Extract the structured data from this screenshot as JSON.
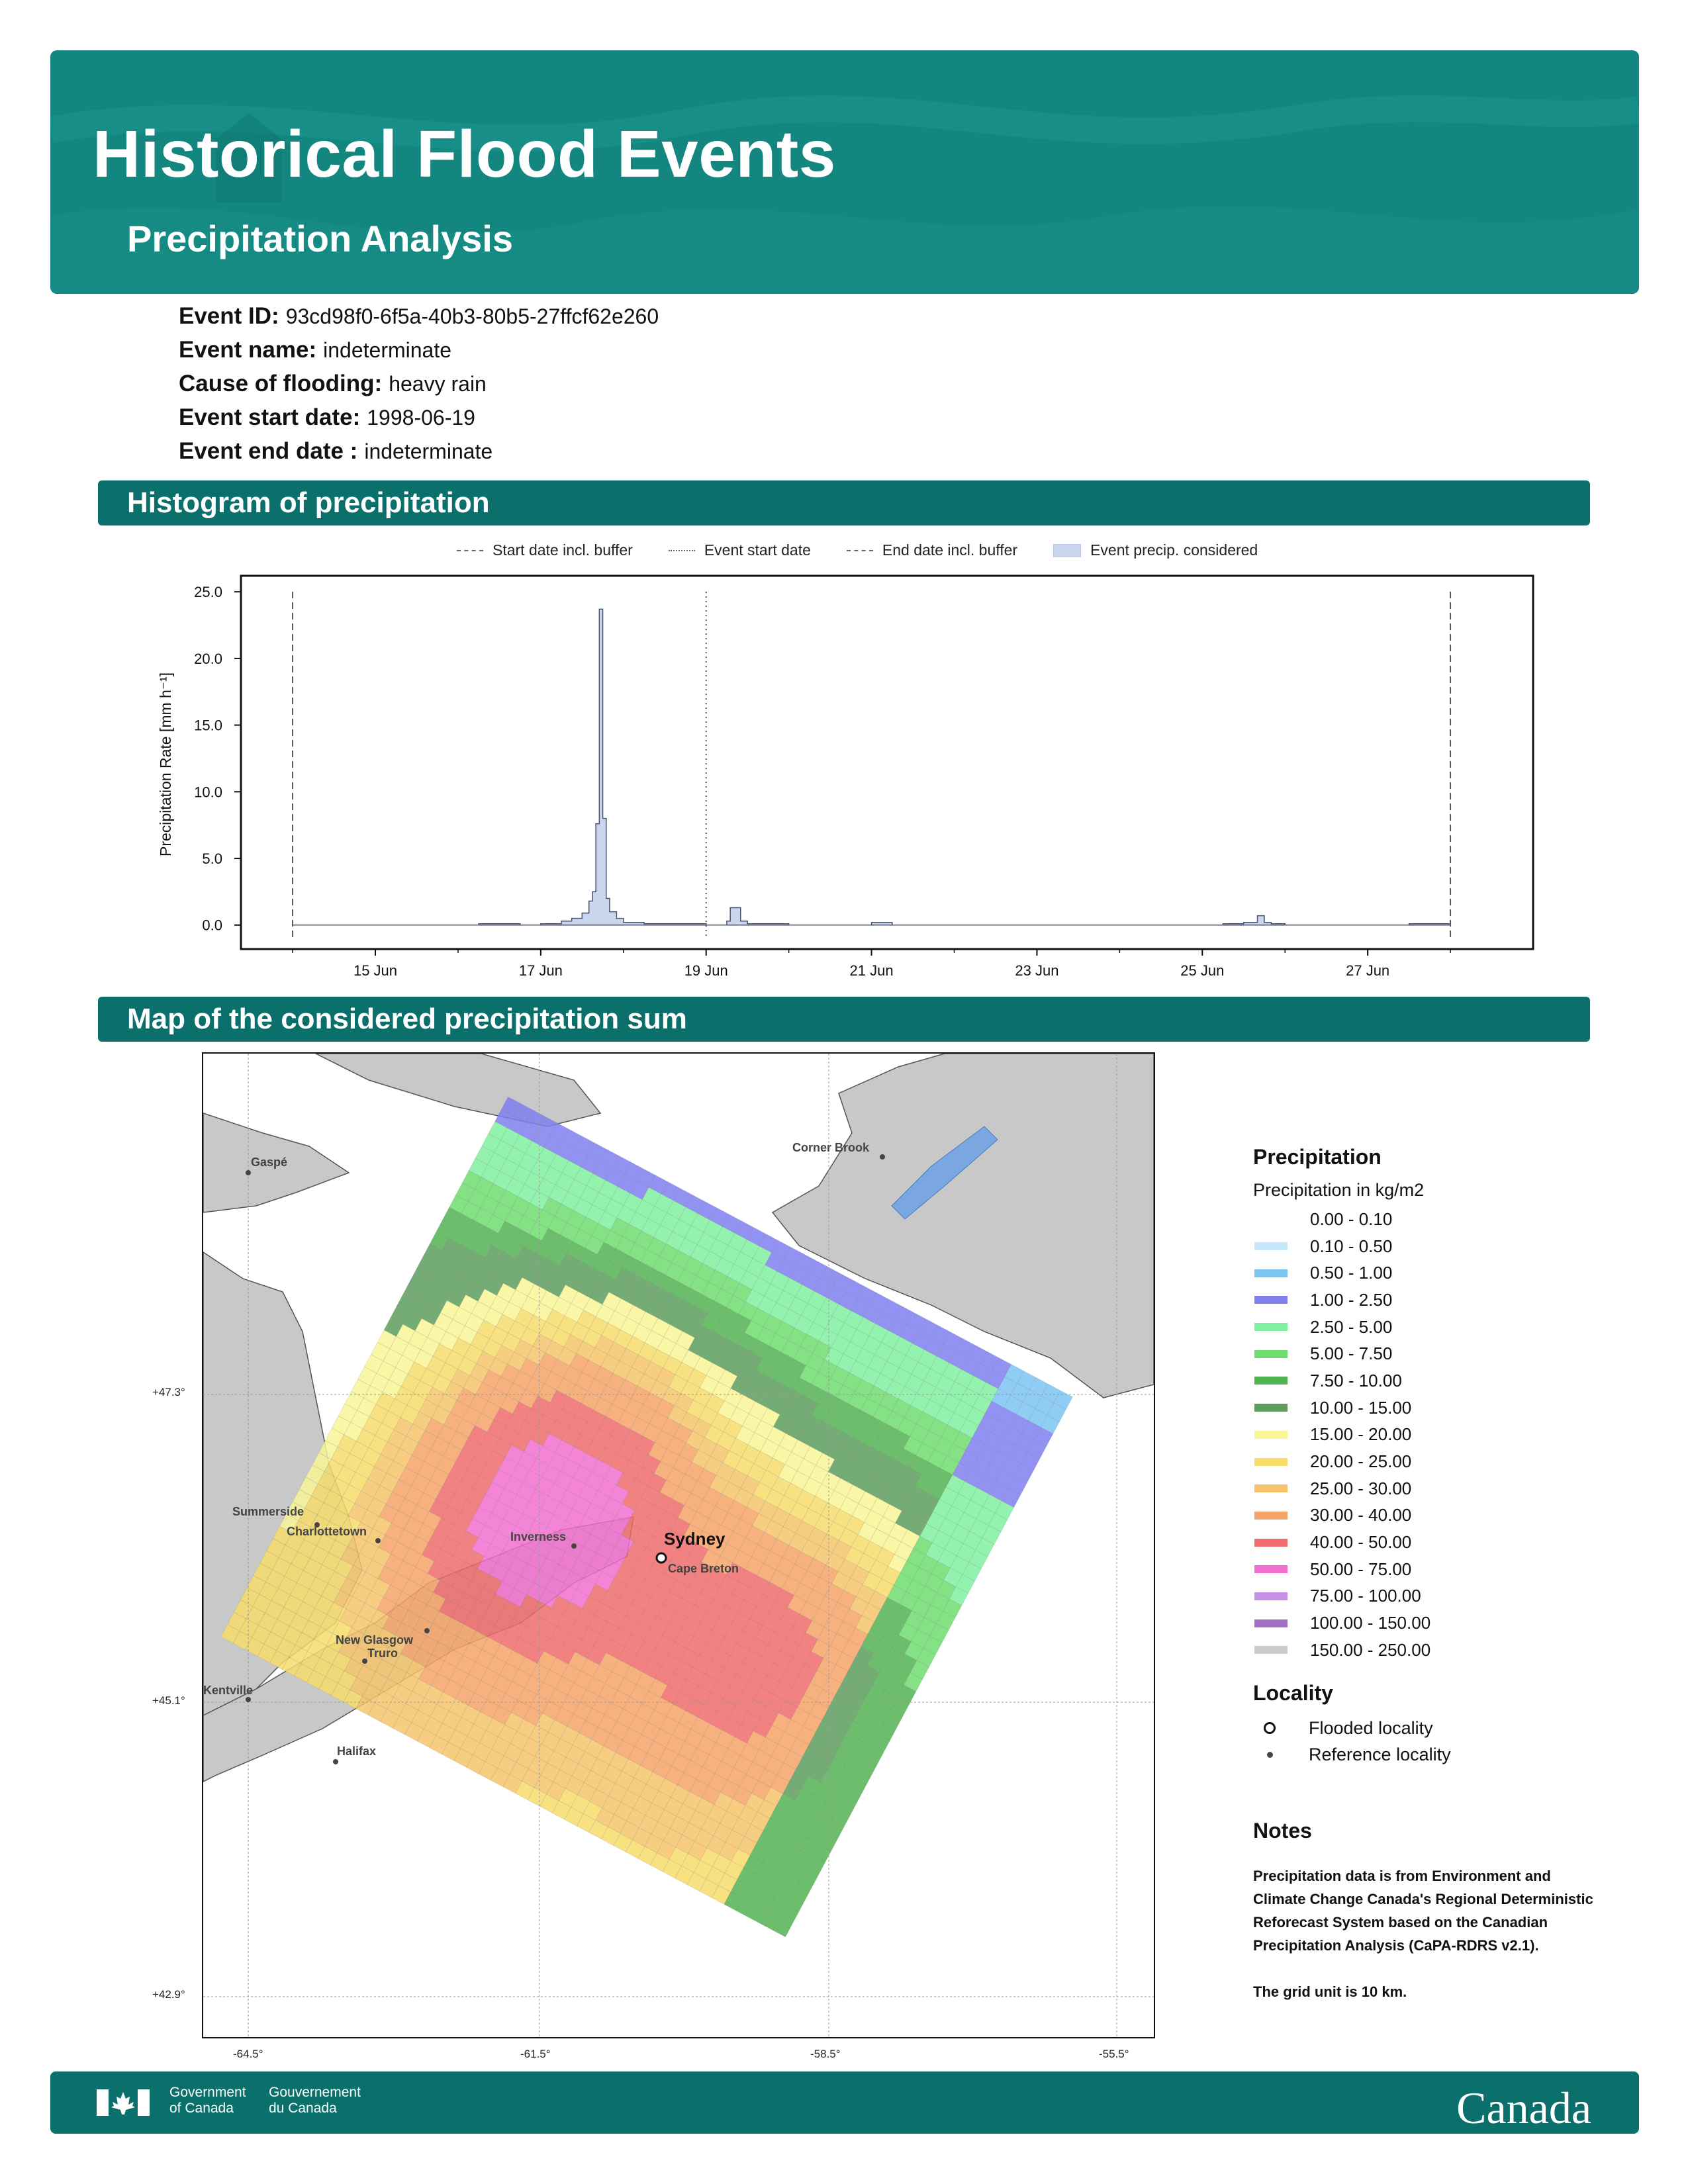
{
  "header": {
    "title": "Historical Flood Events",
    "subtitle": "Precipitation Analysis"
  },
  "event": {
    "id_label": "Event ID:",
    "id": "93cd98f0-6f5a-40b3-80b5-27ffcf62e260",
    "name_label": "Event name:",
    "name": "indeterminate",
    "cause_label": "Cause of flooding:",
    "cause": "heavy rain",
    "start_label": "Event start date:",
    "start": "1998-06-19",
    "end_label": "Event end date :",
    "end": "indeterminate"
  },
  "sections": {
    "histogram": "Histogram of precipitation",
    "map": "Map of the considered precipitation sum"
  },
  "histogram_legend": {
    "start_buffer": "Start date incl. buffer",
    "event_start": "Event start date",
    "end_buffer": "End date incl. buffer",
    "considered": "Event precip. considered"
  },
  "chart_data": {
    "type": "area",
    "ylabel": "Precipitation Rate [mm h⁻¹]",
    "xlabel": "",
    "ylim": [
      -1.8,
      26.2
    ],
    "xlim_days": [
      "1998-06-13T09:00",
      "1998-06-29T00:00"
    ],
    "y_ticks": [
      "0.0",
      "5.0",
      "10.0",
      "15.0",
      "20.0",
      "25.0"
    ],
    "x_ticks": [
      "15 Jun",
      "17 Jun",
      "19 Jun",
      "21 Jun",
      "23 Jun",
      "25 Jun",
      "27 Jun"
    ],
    "start_buffer": "1998-06-14",
    "event_start": "1998-06-19",
    "end_buffer": "1998-06-28",
    "series": [
      {
        "x": [
          "1998-06-14T00:00",
          "1998-06-16T06:00",
          "1998-06-16T12:00",
          "1998-06-16T18:00",
          "1998-06-17T00:00",
          "1998-06-17T06:00",
          "1998-06-17T09:00",
          "1998-06-17T12:00",
          "1998-06-17T14:00",
          "1998-06-17T15:00",
          "1998-06-17T16:00",
          "1998-06-17T17:00",
          "1998-06-17T18:00",
          "1998-06-17T19:00",
          "1998-06-17T20:00",
          "1998-06-17T22:00",
          "1998-06-18T00:00",
          "1998-06-18T06:00",
          "1998-06-18T12:00",
          "1998-06-19T00:00",
          "1998-06-19T06:00",
          "1998-06-19T07:00",
          "1998-06-19T09:00",
          "1998-06-19T10:00",
          "1998-06-19T12:00",
          "1998-06-20T00:00",
          "1998-06-20T18:00",
          "1998-06-21T00:00",
          "1998-06-21T06:00",
          "1998-06-22T00:00",
          "1998-06-24T00:00",
          "1998-06-25T06:00",
          "1998-06-25T12:00",
          "1998-06-25T16:00",
          "1998-06-25T17:00",
          "1998-06-25T18:00",
          "1998-06-25T20:00",
          "1998-06-26T00:00",
          "1998-06-27T00:00",
          "1998-06-27T12:00",
          "1998-06-28T00:00"
        ],
        "y": [
          0.0,
          0.1,
          0.1,
          0.0,
          0.1,
          0.3,
          0.5,
          0.9,
          1.8,
          2.5,
          7.6,
          23.7,
          8.0,
          2.0,
          1.0,
          0.5,
          0.2,
          0.1,
          0.1,
          0.0,
          0.3,
          1.3,
          1.3,
          0.3,
          0.1,
          0.0,
          0.0,
          0.2,
          0.0,
          0.0,
          0.0,
          0.1,
          0.2,
          0.7,
          0.7,
          0.2,
          0.1,
          0.0,
          0.0,
          0.1,
          0.0
        ]
      }
    ]
  },
  "map": {
    "lat_labels": [
      "+47.3°",
      "+45.1°",
      "+42.9°"
    ],
    "lon_labels": [
      "-64.5°",
      "-61.5°",
      "-58.5°",
      "-55.5°"
    ],
    "places": {
      "gaspe": "Gaspé",
      "corner_brook": "Corner Brook",
      "summerside": "Summerside",
      "charlottetown": "Charlottetown",
      "inverness": "Inverness",
      "sydney": "Sydney",
      "cape_breton": "Cape Breton",
      "new_glasgow": "New Glasgow",
      "truro": "Truro",
      "kentville": "Kentville",
      "halifax": "Halifax"
    }
  },
  "legend": {
    "title": "Precipitation",
    "subtitle": "Precipitation in kg/m2",
    "classes": [
      {
        "label": "0.00 - 0.10",
        "color": "#ffffff"
      },
      {
        "label": "0.10 - 0.50",
        "color": "#c6e6fb"
      },
      {
        "label": "0.50 - 1.00",
        "color": "#7cc4f2"
      },
      {
        "label": "1.00 - 2.50",
        "color": "#7f7ff0"
      },
      {
        "label": "2.50 - 5.00",
        "color": "#7ff0a0"
      },
      {
        "label": "5.00 - 7.50",
        "color": "#6fdc6f"
      },
      {
        "label": "7.50 - 10.00",
        "color": "#52b352"
      },
      {
        "label": "10.00 - 15.00",
        "color": "#5d9e5d"
      },
      {
        "label": "15.00 - 20.00",
        "color": "#f8f595"
      },
      {
        "label": "20.00 - 25.00",
        "color": "#f7dc6a"
      },
      {
        "label": "25.00 - 30.00",
        "color": "#f6c46c"
      },
      {
        "label": "30.00 - 40.00",
        "color": "#f4a368"
      },
      {
        "label": "40.00 - 50.00",
        "color": "#f06b6b"
      },
      {
        "label": "50.00 - 75.00",
        "color": "#f26fcf"
      },
      {
        "label": "75.00 - 100.00",
        "color": "#c690e8"
      },
      {
        "label": "100.00 - 150.00",
        "color": "#a06fc0"
      },
      {
        "label": "150.00 - 250.00",
        "color": "#cccccc"
      }
    ]
  },
  "locality": {
    "title": "Locality",
    "flooded": "Flooded locality",
    "reference": "Reference locality"
  },
  "notes": {
    "title": "Notes",
    "text1": "Precipitation data is from Environment and Climate Change Canada's Regional Deterministic Reforecast System based on the Canadian Precipitation Analysis (CaPA-RDRS v2.1).",
    "text2": "The grid unit is 10 km."
  },
  "footer": {
    "gov_en_1": "Government",
    "gov_en_2": "of Canada",
    "gov_fr_1": "Gouvernement",
    "gov_fr_2": "du Canada",
    "wordmark": "Canada"
  }
}
